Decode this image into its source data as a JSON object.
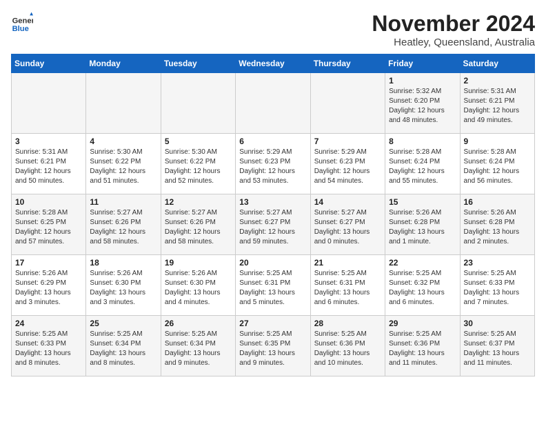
{
  "header": {
    "logo_general": "General",
    "logo_blue": "Blue",
    "month_title": "November 2024",
    "location": "Heatley, Queensland, Australia"
  },
  "weekdays": [
    "Sunday",
    "Monday",
    "Tuesday",
    "Wednesday",
    "Thursday",
    "Friday",
    "Saturday"
  ],
  "weeks": [
    [
      {
        "day": "",
        "info": ""
      },
      {
        "day": "",
        "info": ""
      },
      {
        "day": "",
        "info": ""
      },
      {
        "day": "",
        "info": ""
      },
      {
        "day": "",
        "info": ""
      },
      {
        "day": "1",
        "info": "Sunrise: 5:32 AM\nSunset: 6:20 PM\nDaylight: 12 hours and 48 minutes."
      },
      {
        "day": "2",
        "info": "Sunrise: 5:31 AM\nSunset: 6:21 PM\nDaylight: 12 hours and 49 minutes."
      }
    ],
    [
      {
        "day": "3",
        "info": "Sunrise: 5:31 AM\nSunset: 6:21 PM\nDaylight: 12 hours and 50 minutes."
      },
      {
        "day": "4",
        "info": "Sunrise: 5:30 AM\nSunset: 6:22 PM\nDaylight: 12 hours and 51 minutes."
      },
      {
        "day": "5",
        "info": "Sunrise: 5:30 AM\nSunset: 6:22 PM\nDaylight: 12 hours and 52 minutes."
      },
      {
        "day": "6",
        "info": "Sunrise: 5:29 AM\nSunset: 6:23 PM\nDaylight: 12 hours and 53 minutes."
      },
      {
        "day": "7",
        "info": "Sunrise: 5:29 AM\nSunset: 6:23 PM\nDaylight: 12 hours and 54 minutes."
      },
      {
        "day": "8",
        "info": "Sunrise: 5:28 AM\nSunset: 6:24 PM\nDaylight: 12 hours and 55 minutes."
      },
      {
        "day": "9",
        "info": "Sunrise: 5:28 AM\nSunset: 6:24 PM\nDaylight: 12 hours and 56 minutes."
      }
    ],
    [
      {
        "day": "10",
        "info": "Sunrise: 5:28 AM\nSunset: 6:25 PM\nDaylight: 12 hours and 57 minutes."
      },
      {
        "day": "11",
        "info": "Sunrise: 5:27 AM\nSunset: 6:26 PM\nDaylight: 12 hours and 58 minutes."
      },
      {
        "day": "12",
        "info": "Sunrise: 5:27 AM\nSunset: 6:26 PM\nDaylight: 12 hours and 58 minutes."
      },
      {
        "day": "13",
        "info": "Sunrise: 5:27 AM\nSunset: 6:27 PM\nDaylight: 12 hours and 59 minutes."
      },
      {
        "day": "14",
        "info": "Sunrise: 5:27 AM\nSunset: 6:27 PM\nDaylight: 13 hours and 0 minutes."
      },
      {
        "day": "15",
        "info": "Sunrise: 5:26 AM\nSunset: 6:28 PM\nDaylight: 13 hours and 1 minute."
      },
      {
        "day": "16",
        "info": "Sunrise: 5:26 AM\nSunset: 6:28 PM\nDaylight: 13 hours and 2 minutes."
      }
    ],
    [
      {
        "day": "17",
        "info": "Sunrise: 5:26 AM\nSunset: 6:29 PM\nDaylight: 13 hours and 3 minutes."
      },
      {
        "day": "18",
        "info": "Sunrise: 5:26 AM\nSunset: 6:30 PM\nDaylight: 13 hours and 3 minutes."
      },
      {
        "day": "19",
        "info": "Sunrise: 5:26 AM\nSunset: 6:30 PM\nDaylight: 13 hours and 4 minutes."
      },
      {
        "day": "20",
        "info": "Sunrise: 5:25 AM\nSunset: 6:31 PM\nDaylight: 13 hours and 5 minutes."
      },
      {
        "day": "21",
        "info": "Sunrise: 5:25 AM\nSunset: 6:31 PM\nDaylight: 13 hours and 6 minutes."
      },
      {
        "day": "22",
        "info": "Sunrise: 5:25 AM\nSunset: 6:32 PM\nDaylight: 13 hours and 6 minutes."
      },
      {
        "day": "23",
        "info": "Sunrise: 5:25 AM\nSunset: 6:33 PM\nDaylight: 13 hours and 7 minutes."
      }
    ],
    [
      {
        "day": "24",
        "info": "Sunrise: 5:25 AM\nSunset: 6:33 PM\nDaylight: 13 hours and 8 minutes."
      },
      {
        "day": "25",
        "info": "Sunrise: 5:25 AM\nSunset: 6:34 PM\nDaylight: 13 hours and 8 minutes."
      },
      {
        "day": "26",
        "info": "Sunrise: 5:25 AM\nSunset: 6:34 PM\nDaylight: 13 hours and 9 minutes."
      },
      {
        "day": "27",
        "info": "Sunrise: 5:25 AM\nSunset: 6:35 PM\nDaylight: 13 hours and 9 minutes."
      },
      {
        "day": "28",
        "info": "Sunrise: 5:25 AM\nSunset: 6:36 PM\nDaylight: 13 hours and 10 minutes."
      },
      {
        "day": "29",
        "info": "Sunrise: 5:25 AM\nSunset: 6:36 PM\nDaylight: 13 hours and 11 minutes."
      },
      {
        "day": "30",
        "info": "Sunrise: 5:25 AM\nSunset: 6:37 PM\nDaylight: 13 hours and 11 minutes."
      }
    ]
  ]
}
